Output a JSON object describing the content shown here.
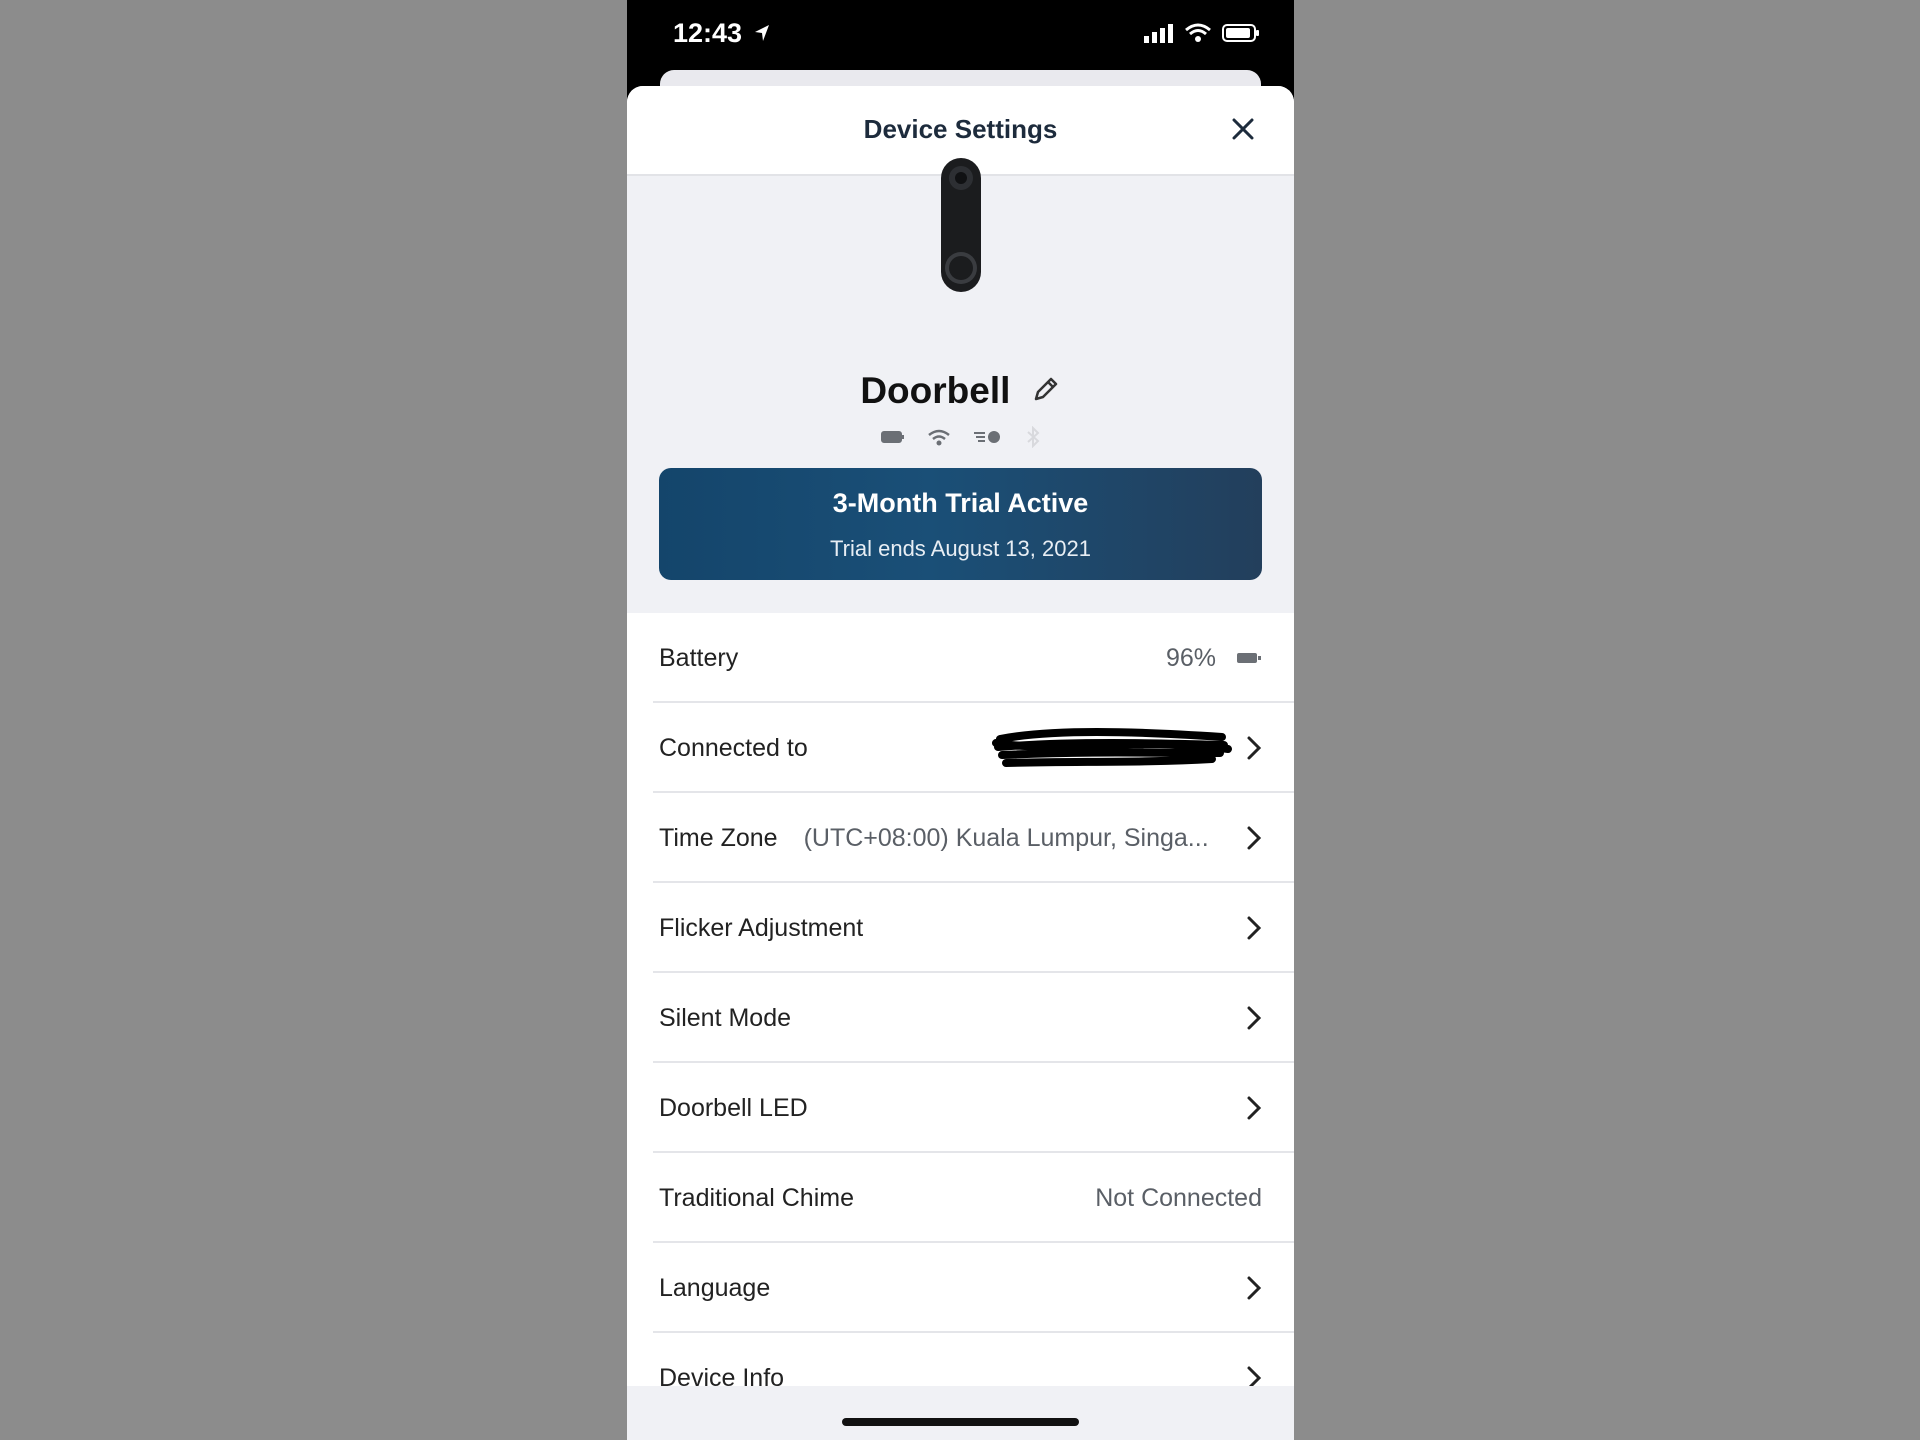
{
  "status_bar": {
    "time": "12:43"
  },
  "header": {
    "title": "Device Settings"
  },
  "device": {
    "name": "Doorbell"
  },
  "trial": {
    "title": "3-Month Trial Active",
    "subtitle": "Trial ends August 13, 2021"
  },
  "settings": [
    {
      "label": "Battery",
      "value": "96%"
    },
    {
      "label": "Connected to",
      "value": ""
    },
    {
      "label": "Time Zone",
      "value": "(UTC+08:00) Kuala Lumpur, Singa..."
    },
    {
      "label": "Flicker Adjustment",
      "value": ""
    },
    {
      "label": "Silent Mode",
      "value": ""
    },
    {
      "label": "Doorbell LED",
      "value": ""
    },
    {
      "label": "Traditional Chime",
      "value": "Not Connected"
    },
    {
      "label": "Language",
      "value": ""
    },
    {
      "label": "Device Info",
      "value": ""
    }
  ],
  "colors": {
    "banner": "#1a4f77",
    "background": "#8c8c8c",
    "sheet": "#f0f1f5"
  }
}
